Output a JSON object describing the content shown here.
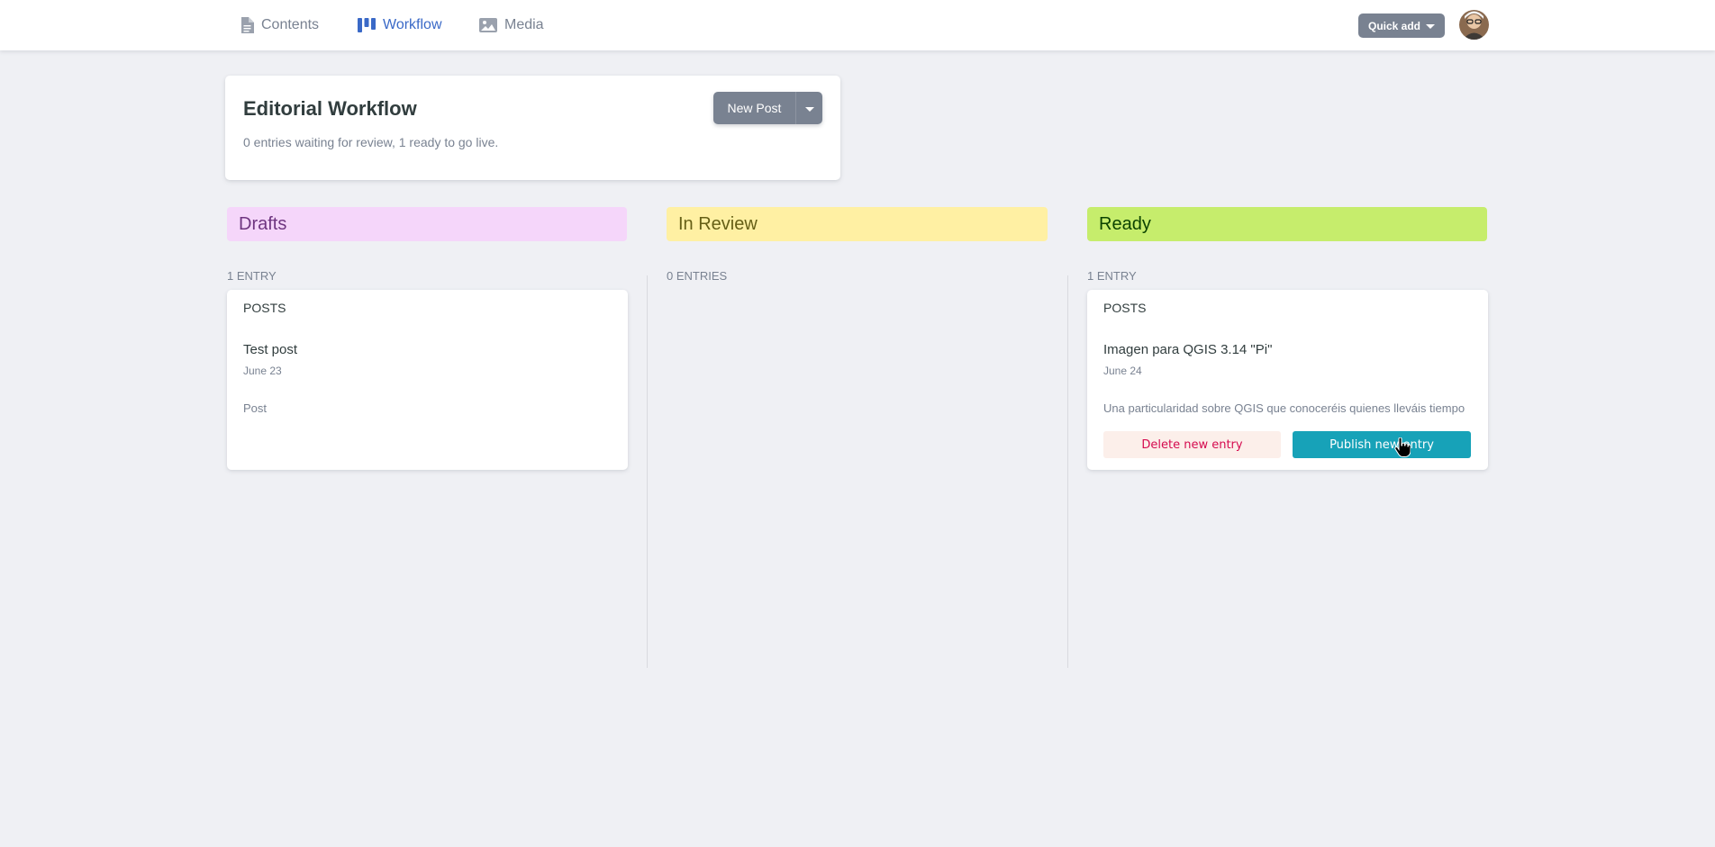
{
  "nav": {
    "items": [
      {
        "label": "Contents",
        "icon": "document-icon",
        "active": false
      },
      {
        "label": "Workflow",
        "icon": "kanban-icon",
        "active": true
      },
      {
        "label": "Media",
        "icon": "image-icon",
        "active": false
      }
    ],
    "quick_add_label": "Quick add"
  },
  "header": {
    "title": "Editorial Workflow",
    "description": "0 entries waiting for review, 1 ready to go live.",
    "new_post_label": "New Post"
  },
  "columns": [
    {
      "title": "Drafts",
      "count": "1 entry",
      "colors": {
        "bg": "#f5d6fa",
        "text": "#6e3580"
      },
      "cards": [
        {
          "collection": "Posts",
          "title": "Test post",
          "date": "June 23",
          "body": "Post"
        }
      ]
    },
    {
      "title": "In Review",
      "count": "0 entries",
      "colors": {
        "bg": "#fff0a3",
        "text": "#655f16"
      },
      "cards": []
    },
    {
      "title": "Ready",
      "count": "1 entry",
      "colors": {
        "bg": "#c6ed6c",
        "text": "#0b4300"
      },
      "cards": [
        {
          "collection": "Posts",
          "title": "Imagen para QGIS 3.14 \"Pi\"",
          "date": "June 24",
          "body": "Una particularidad sobre QGIS que conoceréis quienes lleváis tiempo",
          "delete_label": "Delete new entry",
          "publish_label": "Publish new entry"
        }
      ]
    }
  ],
  "colors": {
    "accent": "#3a69c7",
    "publish": "#17a2b8",
    "delete_text": "#d50b4f",
    "delete_bg": "#fcefea",
    "background": "#eff0f4"
  }
}
